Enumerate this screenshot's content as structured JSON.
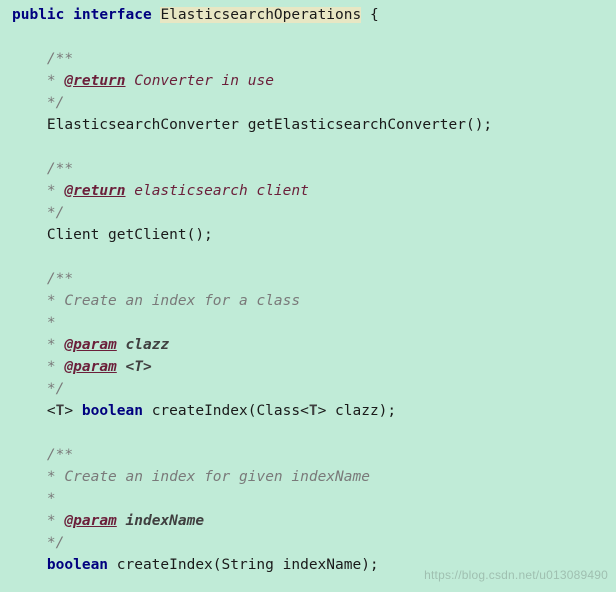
{
  "decl": {
    "kw_public": "public",
    "kw_interface": "interface",
    "name": "ElasticsearchOperations",
    "brace": "{"
  },
  "blocks": [
    {
      "jd_open": "/**",
      "jd_lines": [
        {
          "star": " * ",
          "tag": "@return",
          "after": " Converter in use"
        }
      ],
      "jd_close": " */",
      "sig_tokens": [
        {
          "t": "ElasticsearchConverter ",
          "c": "type"
        },
        {
          "t": "getElasticsearchConverter();",
          "c": "punct"
        }
      ]
    },
    {
      "jd_open": "/**",
      "jd_lines": [
        {
          "star": " * ",
          "tag": "@return",
          "after": " elasticsearch client"
        }
      ],
      "jd_close": " */",
      "sig_tokens": [
        {
          "t": "Client ",
          "c": "type"
        },
        {
          "t": "getClient();",
          "c": "punct"
        }
      ]
    },
    {
      "jd_open": "/**",
      "jd_lines": [
        {
          "star": " * ",
          "desc": "Create an index for a class"
        },
        {
          "star": " *",
          "desc": ""
        },
        {
          "star": " * ",
          "tag": "@param",
          "param": " clazz"
        },
        {
          "star": " * ",
          "tag": "@param",
          "param": " <T>"
        }
      ],
      "jd_close": " */",
      "sig_tokens": [
        {
          "t": "<",
          "c": "punct"
        },
        {
          "t": "T",
          "c": "gen"
        },
        {
          "t": "> ",
          "c": "punct"
        },
        {
          "t": "boolean",
          "c": "kw"
        },
        {
          "t": " createIndex(Class<",
          "c": "punct"
        },
        {
          "t": "T",
          "c": "gen"
        },
        {
          "t": "> clazz);",
          "c": "punct"
        }
      ]
    },
    {
      "jd_open": "/**",
      "jd_lines": [
        {
          "star": " * ",
          "desc": "Create an index for given indexName"
        },
        {
          "star": " *",
          "desc": ""
        },
        {
          "star": " * ",
          "tag": "@param",
          "param": " indexName"
        }
      ],
      "jd_close": " */",
      "sig_tokens": [
        {
          "t": "boolean",
          "c": "kw"
        },
        {
          "t": " createIndex(String indexName);",
          "c": "punct"
        }
      ]
    }
  ],
  "watermark": "https://blog.csdn.net/u013089490"
}
